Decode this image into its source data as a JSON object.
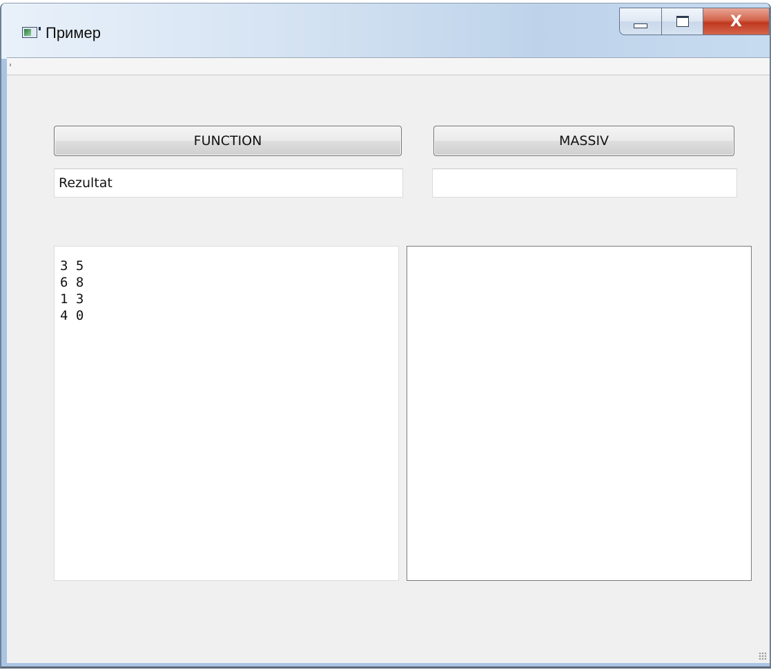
{
  "window": {
    "title": "Пример",
    "icon": "app-window-icon",
    "controls": {
      "minimize_icon": "minimize-icon",
      "maximize_icon": "maximize-icon",
      "close_label": "X"
    }
  },
  "buttons": {
    "function_label": "FUNCTION",
    "massiv_label": "MASSIV"
  },
  "fields": {
    "result_value": "Rezultat",
    "massiv_value": ""
  },
  "text_areas": {
    "left_content": "3 5\n6 8\n1 3\n4 0",
    "right_content": ""
  },
  "colors": {
    "close_button": "#c0391f",
    "client_background": "#f0f0f0"
  }
}
